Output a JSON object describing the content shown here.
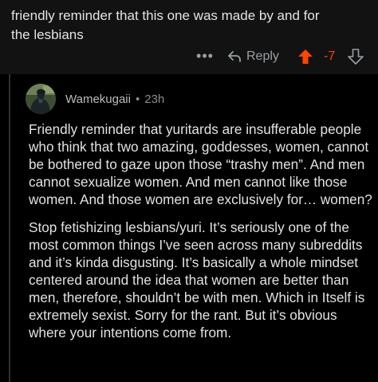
{
  "parent_comment": {
    "text": "friendly reminder that this one was made by and for\nthe lesbians",
    "more_label": "•••",
    "reply_label": "Reply",
    "vote_count": "-7"
  },
  "reply_comment": {
    "username": "Wamekugaii",
    "separator": "•",
    "timestamp": "23h",
    "paragraphs": [
      "Friendly reminder that yuritards are insufferable people who think that two amazing, goddesses, women, cannot be bothered to gaze upon those “trashy men”. And men cannot sexualize women. And men cannot like those women. And those women are exclusively for… women?",
      "Stop fetishizing lesbians/yuri. It’s seriously one of the most common things I’ve seen across many subreddits and it’s kinda disgusting. It’s basically a whole mindset centered around the idea that women are better than men, therefore, shouldn’t be with men. Which in Itself is extremely sexist. Sorry for the rant. But it’s obvious where your intentions come from."
    ]
  },
  "icons": {
    "more": "more-dots-icon",
    "reply": "reply-arrow-icon",
    "upvote": "upvote-arrow-icon",
    "downvote": "downvote-arrow-icon",
    "avatar": "user-avatar-image"
  },
  "colors": {
    "background": "#000000",
    "parent_background": "#121212",
    "upvote_active": "#ff4500",
    "muted_text": "#9aa0a3",
    "body_text": "#e2e2e2"
  }
}
